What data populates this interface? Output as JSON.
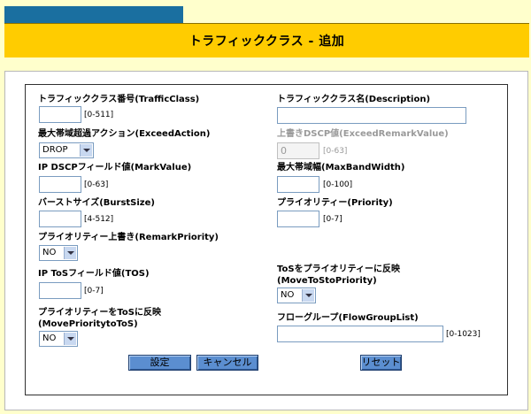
{
  "page": {
    "title": "トラフィッククラス - 追加"
  },
  "form": {
    "traffic_class": {
      "label": "トラフィッククラス番号(TrafficClass)",
      "value": "",
      "range": "[0-511]"
    },
    "description": {
      "label": "トラフィッククラス名(Description)",
      "value": ""
    },
    "exceed_action": {
      "label": "最大帯域超過アクション(ExceedAction)",
      "value": "DROP"
    },
    "exceed_remark_value": {
      "label": "上書きDSCP値(ExceedRemarkValue)",
      "value": "0",
      "range": "[0-63]"
    },
    "mark_value": {
      "label": "IP DSCPフィールド値(MarkValue)",
      "value": "",
      "range": "[0-63]"
    },
    "max_bandwidth": {
      "label": "最大帯域幅(MaxBandWidth)",
      "value": "",
      "range": "[0-100]"
    },
    "burst_size": {
      "label": "バーストサイズ(BurstSize)",
      "value": "",
      "range": "[4-512]"
    },
    "priority": {
      "label": "プライオリティー(Priority)",
      "value": "",
      "range": "[0-7]"
    },
    "remark_priority": {
      "label": "プライオリティー上書き(RemarkPriority)",
      "value": "NO"
    },
    "tos": {
      "label": "IP ToSフィールド値(TOS)",
      "value": "",
      "range": "[0-7]"
    },
    "move_tos_to_priority": {
      "label_line1": "ToSをプライオリティーに反映",
      "label_line2": "(MoveToStoPriority)",
      "value": "NO"
    },
    "move_priority_to_tos": {
      "label_line1": "プライオリティーをToSに反映",
      "label_line2": "(MovePrioritytoToS)",
      "value": "NO"
    },
    "flow_group_list": {
      "label": "フローグループ(FlowGroupList)",
      "value": "",
      "range": "[0-1023]"
    }
  },
  "buttons": {
    "submit": "設定",
    "cancel": "キャンセル",
    "reset": "リセット"
  }
}
